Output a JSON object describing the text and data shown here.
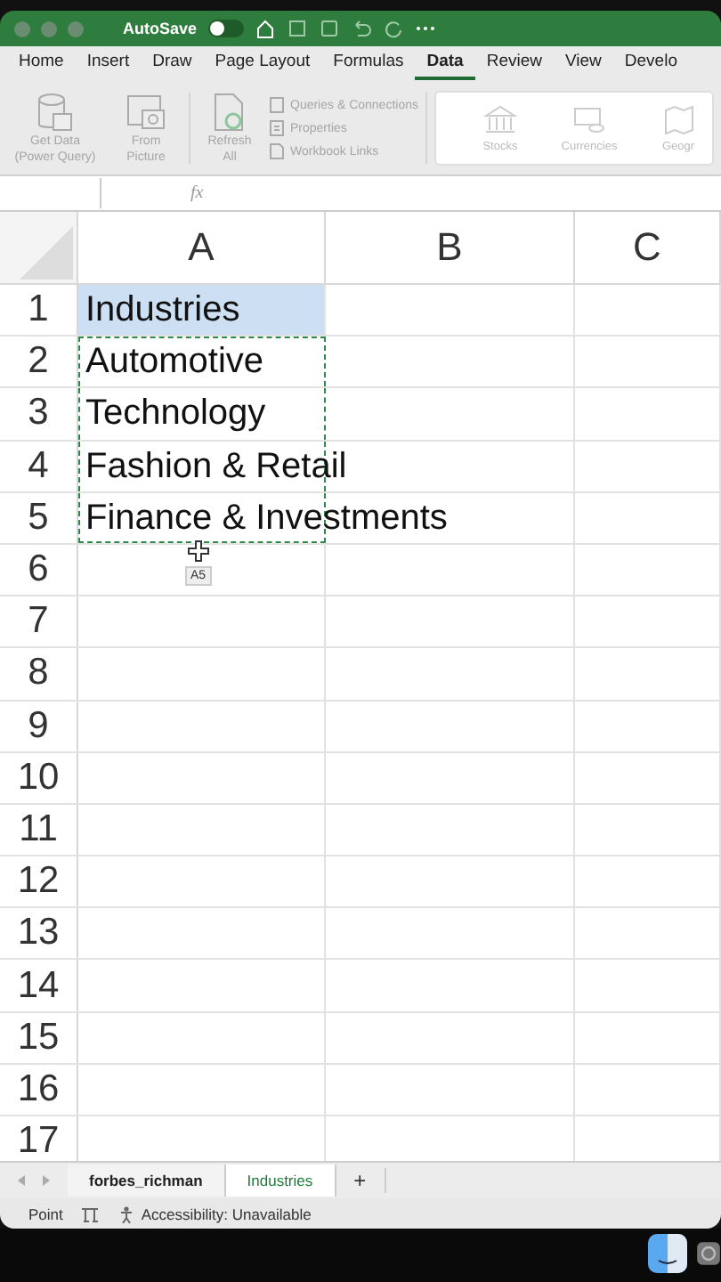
{
  "title_bar": {
    "autosave_label": "AutoSave",
    "autosave_on": false
  },
  "tabs": [
    {
      "label": "Home",
      "selected": false
    },
    {
      "label": "Insert",
      "selected": false
    },
    {
      "label": "Draw",
      "selected": false
    },
    {
      "label": "Page Layout",
      "selected": false
    },
    {
      "label": "Formulas",
      "selected": false
    },
    {
      "label": "Data",
      "selected": true
    },
    {
      "label": "Review",
      "selected": false
    },
    {
      "label": "View",
      "selected": false
    },
    {
      "label": "Develo",
      "selected": false
    }
  ],
  "ribbon": {
    "large_buttons": [
      {
        "kind": "database",
        "label": "Get Data (Power Query)",
        "disabled": true
      },
      {
        "kind": "picture",
        "label": "From Picture",
        "disabled": true
      },
      {
        "kind": "refresh",
        "label": "Refresh All",
        "disabled": true
      }
    ],
    "small_buttons": [
      {
        "kind": "queries",
        "label": "Queries & Connections",
        "disabled": true
      },
      {
        "kind": "properties",
        "label": "Properties",
        "disabled": true
      },
      {
        "kind": "links",
        "label": "Workbook Links",
        "disabled": true
      }
    ],
    "data_types": [
      {
        "kind": "bank",
        "label": "Stocks"
      },
      {
        "kind": "money",
        "label": "Currencies"
      },
      {
        "kind": "map",
        "label": "Geogr"
      }
    ]
  },
  "formula_bar": {
    "fx": "fx"
  },
  "columns": [
    {
      "label": "A"
    },
    {
      "label": "B"
    },
    {
      "label": "C"
    }
  ],
  "rows": [
    {
      "number": "1",
      "value": "Industries",
      "selected": true,
      "copied": false
    },
    {
      "number": "2",
      "value": "Automotive",
      "selected": false,
      "copied": true
    },
    {
      "number": "3",
      "value": "Technology",
      "selected": false,
      "copied": true
    },
    {
      "number": "4",
      "value": "Fashion & Retail",
      "selected": false,
      "copied": true
    },
    {
      "number": "5",
      "value": "Finance & Investments",
      "selected": false,
      "copied": true
    },
    {
      "number": "6",
      "value": "",
      "selected": false,
      "copied": false
    },
    {
      "number": "7",
      "value": "",
      "selected": false,
      "copied": false
    },
    {
      "number": "8",
      "value": "",
      "selected": false,
      "copied": false
    },
    {
      "number": "9",
      "value": "",
      "selected": false,
      "copied": false
    },
    {
      "number": "10",
      "value": "",
      "selected": false,
      "copied": false
    },
    {
      "number": "11",
      "value": "",
      "selected": false,
      "copied": false
    },
    {
      "number": "12",
      "value": "",
      "selected": false,
      "copied": false
    },
    {
      "number": "13",
      "value": "",
      "selected": false,
      "copied": false
    },
    {
      "number": "14",
      "value": "",
      "selected": false,
      "copied": false
    },
    {
      "number": "15",
      "value": "",
      "selected": false,
      "copied": false
    },
    {
      "number": "16",
      "value": "",
      "selected": false,
      "copied": false
    },
    {
      "number": "17",
      "value": "",
      "selected": false,
      "copied": false
    }
  ],
  "cell_tooltip": "A5",
  "sheet_tabs": [
    {
      "label": "forbes_richman",
      "selected": false
    },
    {
      "label": "Industries",
      "selected": true
    }
  ],
  "add_sheet": "+",
  "status_bar": {
    "mode": "Point",
    "accessibility": "Accessibility: Unavailable"
  }
}
